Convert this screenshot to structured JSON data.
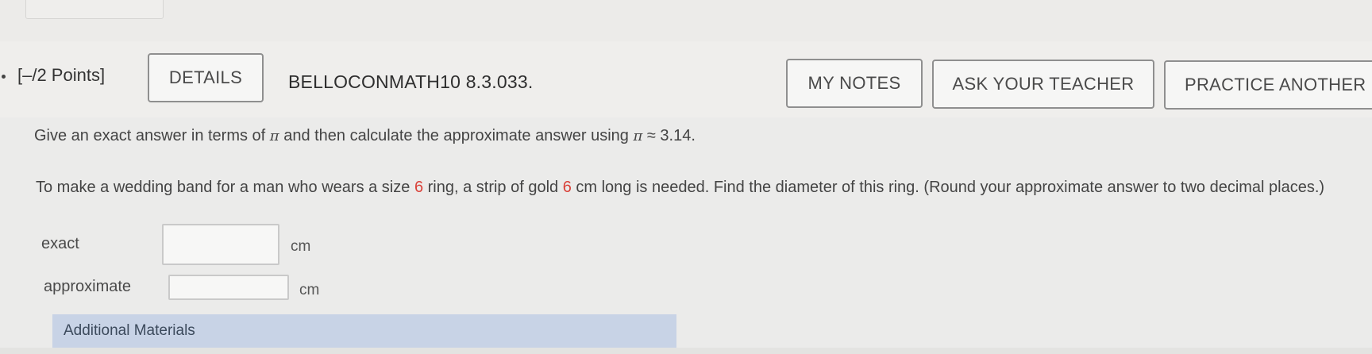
{
  "question": {
    "points": "[–/2 Points]",
    "details_label": "DETAILS",
    "problem_id": "BELLOCONMATH10 8.3.033.",
    "buttons": {
      "my_notes": "MY NOTES",
      "ask_teacher": "ASK YOUR TEACHER",
      "practice_another": "PRACTICE ANOTHER"
    },
    "intro": {
      "before_pi": "Give an exact answer in terms of ",
      "pi_symbol": "π",
      "middle": " and then calculate the approximate answer using ",
      "pi_symbol_2": "π",
      "approx": " ≈ 3.14."
    },
    "body": {
      "part1": "To make a wedding band for a man who wears a size ",
      "ring_size": "6",
      "part2": " ring, a strip of gold ",
      "length": "6",
      "part3": " cm long is needed. Find the diameter of this ring. (Round your approximate answer to two decimal places.)"
    },
    "answers": {
      "exact_label": "exact",
      "exact_value": "",
      "exact_unit": "cm",
      "approx_label": "approximate",
      "approx_value": "",
      "approx_unit": "cm"
    },
    "additional_materials": "Additional Materials"
  },
  "colors": {
    "highlight": "#d9423a",
    "materials_bar": "#c8d3e6"
  }
}
